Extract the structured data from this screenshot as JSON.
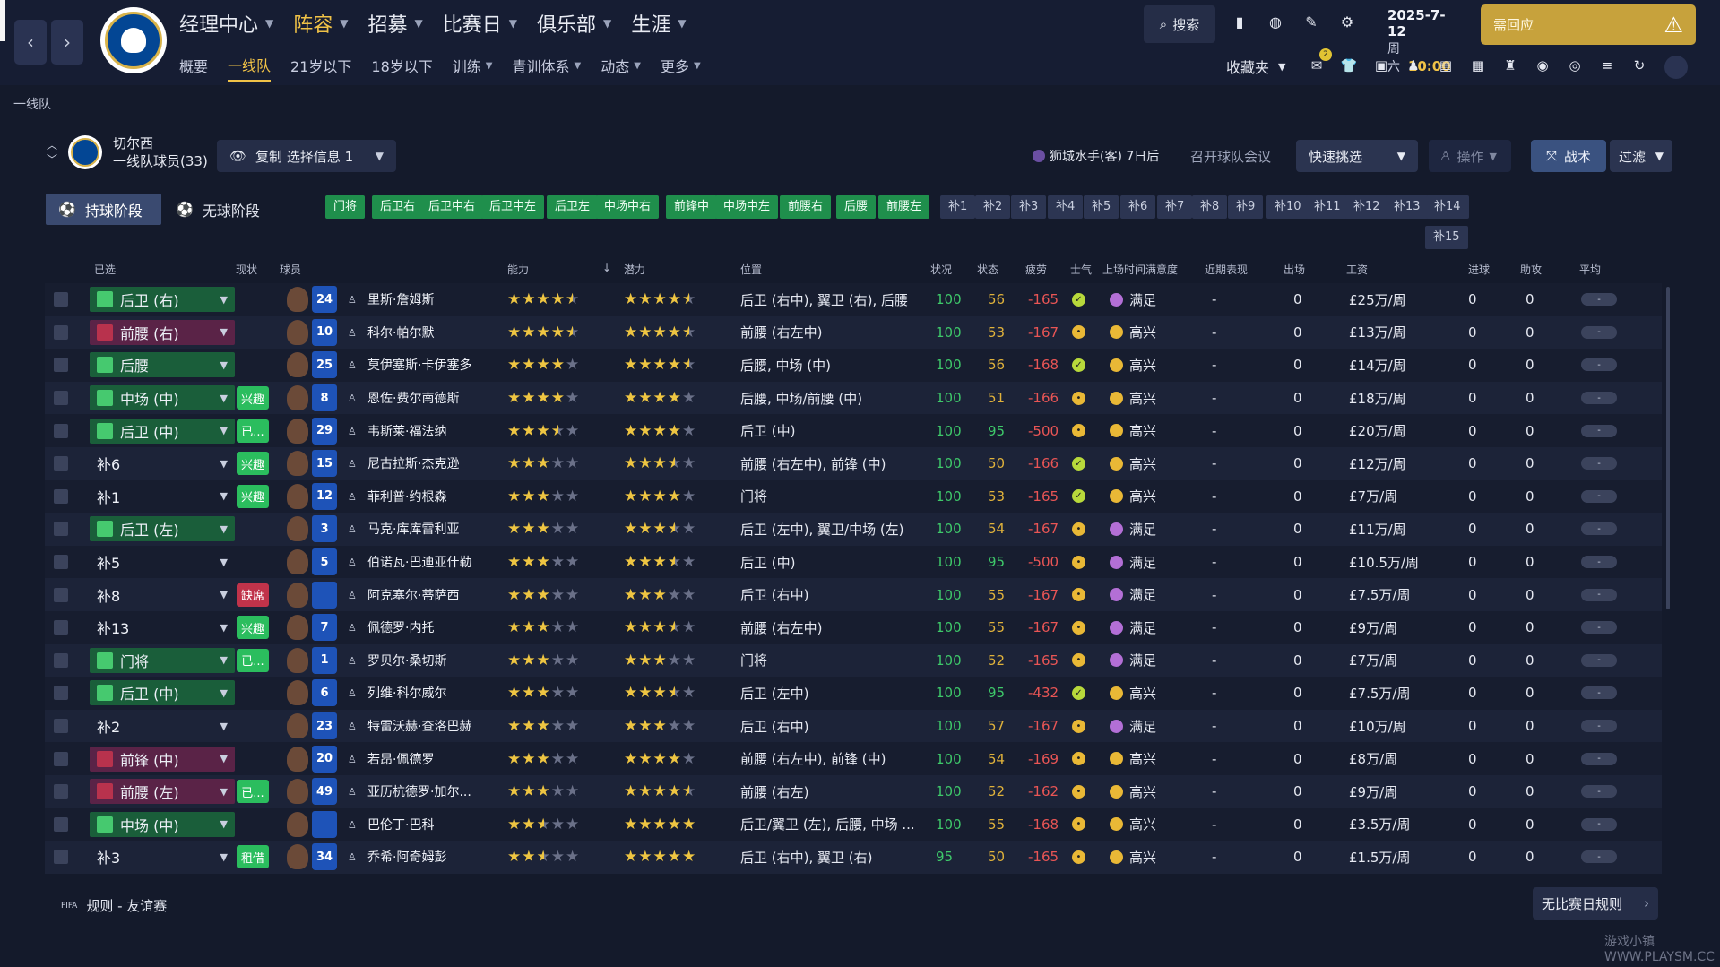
{
  "header": {
    "main_nav": [
      {
        "label": "经理中心",
        "active": false
      },
      {
        "label": "阵容",
        "active": true
      },
      {
        "label": "招募",
        "active": false
      },
      {
        "label": "比赛日",
        "active": false
      },
      {
        "label": "俱乐部",
        "active": false
      },
      {
        "label": "生涯",
        "active": false
      }
    ],
    "sub_nav": [
      {
        "label": "概要",
        "active": false,
        "dropdown": false
      },
      {
        "label": "一线队",
        "active": true,
        "dropdown": false
      },
      {
        "label": "21岁以下",
        "active": false,
        "dropdown": false
      },
      {
        "label": "18岁以下",
        "active": false,
        "dropdown": false
      },
      {
        "label": "训练",
        "active": false,
        "dropdown": true
      },
      {
        "label": "青训体系",
        "active": false,
        "dropdown": true
      },
      {
        "label": "动态",
        "active": false,
        "dropdown": true
      },
      {
        "label": "更多",
        "active": false,
        "dropdown": true
      }
    ],
    "search_label": "搜索",
    "date": "2025-7-12",
    "weekday": "周六",
    "time": "10:00",
    "respond_label": "需回应",
    "favorites_label": "收藏夹",
    "notification_count": "2",
    "accent_color": "#f0c247"
  },
  "breadcrumb": "一线队",
  "team": {
    "name": "切尔西",
    "squad_label": "一线队球员(33)",
    "copy_button": "复制 选择信息 1",
    "next_fixture": "狮城水手(客) 7日后",
    "meeting_label": "召开球队会议",
    "quick_pick_label": "快速挑选",
    "action_label": "操作",
    "tactics_label": "战术",
    "filter_label": "过滤"
  },
  "phases": {
    "in_possession": "持球阶段",
    "out_of_possession": "无球阶段"
  },
  "positions": [
    "门将",
    "后卫右",
    "后卫中右",
    "后卫中左",
    "后卫左",
    "中场中右",
    "前锋中",
    "中场中左",
    "前腰右",
    "后腰",
    "前腰左"
  ],
  "subs": [
    "补1",
    "补2",
    "补3",
    "补4",
    "补5",
    "补6",
    "补7",
    "补8",
    "补9",
    "补10",
    "补11",
    "补12",
    "补13",
    "补14",
    "补15"
  ],
  "columns": {
    "selected": "已选",
    "status": "现状",
    "player": "球员",
    "ability": "能力",
    "potential": "潜力",
    "position": "位置",
    "condition": "状况",
    "form": "状态",
    "fatigue": "疲劳",
    "morale": "士气",
    "playtime": "上场时间满意度",
    "recent": "近期表现",
    "apps": "出场",
    "wage": "工资",
    "goals": "进球",
    "assists": "助攻",
    "avg": "平均"
  },
  "players": [
    {
      "selected": "后卫 (右)",
      "sel_style": "green",
      "status": "",
      "status_style": "",
      "number": "24",
      "name": "里斯·詹姆斯",
      "ability": 4.5,
      "potential": 4.5,
      "position": "后卫 (右中), 翼卫 (右), 后腰",
      "condition": "100",
      "form": "56",
      "fatigue": "-165",
      "morale": "g",
      "playtime": "满足",
      "sat": "p",
      "recent": "-",
      "apps": "0",
      "wage": "£25万/周",
      "goals": "0",
      "assists": "0",
      "avg": "-"
    },
    {
      "selected": "前腰 (右)",
      "sel_style": "purple",
      "status": "",
      "status_style": "",
      "number": "10",
      "name": "科尔·帕尔默",
      "ability": 4.5,
      "potential": 4.5,
      "position": "前腰 (右左中)",
      "condition": "100",
      "form": "53",
      "fatigue": "-167",
      "morale": "y",
      "playtime": "高兴",
      "sat": "y",
      "recent": "-",
      "apps": "0",
      "wage": "£13万/周",
      "goals": "0",
      "assists": "0",
      "avg": "-"
    },
    {
      "selected": "后腰",
      "sel_style": "green",
      "status": "",
      "status_style": "",
      "number": "25",
      "name": "莫伊塞斯·卡伊塞多",
      "ability": 4.0,
      "potential": 4.5,
      "position": "后腰, 中场 (中)",
      "condition": "100",
      "form": "56",
      "fatigue": "-168",
      "morale": "g",
      "playtime": "高兴",
      "sat": "y",
      "recent": "-",
      "apps": "0",
      "wage": "£14万/周",
      "goals": "0",
      "assists": "0",
      "avg": "-"
    },
    {
      "selected": "中场 (中)",
      "sel_style": "green",
      "status": "兴趣",
      "status_style": "g",
      "number": "8",
      "name": "恩佐·费尔南德斯",
      "ability": 4.0,
      "potential": 4.0,
      "position": "后腰, 中场/前腰 (中)",
      "condition": "100",
      "form": "51",
      "fatigue": "-166",
      "morale": "y",
      "playtime": "高兴",
      "sat": "y",
      "recent": "-",
      "apps": "0",
      "wage": "£18万/周",
      "goals": "0",
      "assists": "0",
      "avg": "-"
    },
    {
      "selected": "后卫 (中)",
      "sel_style": "green",
      "status": "已...",
      "status_style": "g",
      "number": "29",
      "name": "韦斯莱·福法纳",
      "ability": 3.5,
      "potential": 4.0,
      "position": "后卫 (中)",
      "condition": "100",
      "form": "95",
      "fatigue": "-500",
      "morale": "y",
      "playtime": "高兴",
      "sat": "y",
      "recent": "-",
      "apps": "0",
      "wage": "£20万/周",
      "goals": "0",
      "assists": "0",
      "avg": "-"
    },
    {
      "selected": "补6",
      "sel_style": "none",
      "status": "兴趣",
      "status_style": "g",
      "number": "15",
      "name": "尼古拉斯·杰克逊",
      "ability": 3.0,
      "potential": 3.5,
      "position": "前腰 (右左中), 前锋 (中)",
      "condition": "100",
      "form": "50",
      "fatigue": "-166",
      "morale": "g",
      "playtime": "高兴",
      "sat": "y",
      "recent": "-",
      "apps": "0",
      "wage": "£12万/周",
      "goals": "0",
      "assists": "0",
      "avg": "-"
    },
    {
      "selected": "补1",
      "sel_style": "none",
      "status": "兴趣",
      "status_style": "g",
      "number": "12",
      "name": "菲利普·约根森",
      "ability": 3.0,
      "potential": 4.0,
      "position": "门将",
      "condition": "100",
      "form": "53",
      "fatigue": "-165",
      "morale": "g",
      "playtime": "高兴",
      "sat": "y",
      "recent": "-",
      "apps": "0",
      "wage": "£7万/周",
      "goals": "0",
      "assists": "0",
      "avg": "-"
    },
    {
      "selected": "后卫 (左)",
      "sel_style": "green",
      "status": "",
      "status_style": "",
      "number": "3",
      "name": "马克·库库雷利亚",
      "ability": 3.0,
      "potential": 3.5,
      "position": "后卫 (左中), 翼卫/中场 (左)",
      "condition": "100",
      "form": "54",
      "fatigue": "-167",
      "morale": "y",
      "playtime": "满足",
      "sat": "p",
      "recent": "-",
      "apps": "0",
      "wage": "£11万/周",
      "goals": "0",
      "assists": "0",
      "avg": "-"
    },
    {
      "selected": "补5",
      "sel_style": "none",
      "status": "",
      "status_style": "",
      "number": "5",
      "name": "伯诺瓦·巴迪亚什勒",
      "ability": 3.0,
      "potential": 3.5,
      "position": "后卫 (中)",
      "condition": "100",
      "form": "95",
      "fatigue": "-500",
      "morale": "y",
      "playtime": "满足",
      "sat": "p",
      "recent": "-",
      "apps": "0",
      "wage": "£10.5万/周",
      "goals": "0",
      "assists": "0",
      "avg": "-"
    },
    {
      "selected": "补8",
      "sel_style": "none",
      "status": "缺席",
      "status_style": "r",
      "number": "",
      "name": "阿克塞尔·蒂萨西",
      "ability": 3.0,
      "potential": 3.0,
      "position": "后卫 (右中)",
      "condition": "100",
      "form": "55",
      "fatigue": "-167",
      "morale": "y",
      "playtime": "满足",
      "sat": "p",
      "recent": "-",
      "apps": "0",
      "wage": "£7.5万/周",
      "goals": "0",
      "assists": "0",
      "avg": "-"
    },
    {
      "selected": "补13",
      "sel_style": "none",
      "status": "兴趣",
      "status_style": "g",
      "number": "7",
      "name": "佩德罗·内托",
      "ability": 3.0,
      "potential": 3.5,
      "position": "前腰 (右左中)",
      "condition": "100",
      "form": "55",
      "fatigue": "-167",
      "morale": "y",
      "playtime": "满足",
      "sat": "p",
      "recent": "-",
      "apps": "0",
      "wage": "£9万/周",
      "goals": "0",
      "assists": "0",
      "avg": "-"
    },
    {
      "selected": "门将",
      "sel_style": "green",
      "status": "已...",
      "status_style": "g",
      "number": "1",
      "name": "罗贝尔·桑切斯",
      "ability": 3.0,
      "potential": 3.0,
      "position": "门将",
      "condition": "100",
      "form": "52",
      "fatigue": "-165",
      "morale": "y",
      "playtime": "满足",
      "sat": "p",
      "recent": "-",
      "apps": "0",
      "wage": "£7万/周",
      "goals": "0",
      "assists": "0",
      "avg": "-"
    },
    {
      "selected": "后卫 (中)",
      "sel_style": "green",
      "status": "",
      "status_style": "",
      "number": "6",
      "name": "列维·科尔威尔",
      "ability": 3.0,
      "potential": 3.5,
      "position": "后卫 (左中)",
      "condition": "100",
      "form": "95",
      "fatigue": "-432",
      "morale": "g",
      "playtime": "高兴",
      "sat": "y",
      "recent": "-",
      "apps": "0",
      "wage": "£7.5万/周",
      "goals": "0",
      "assists": "0",
      "avg": "-"
    },
    {
      "selected": "补2",
      "sel_style": "none",
      "status": "",
      "status_style": "",
      "number": "23",
      "name": "特雷沃赫·查洛巴赫",
      "ability": 3.0,
      "potential": 3.0,
      "position": "后卫 (右中)",
      "condition": "100",
      "form": "57",
      "fatigue": "-167",
      "morale": "y",
      "playtime": "满足",
      "sat": "p",
      "recent": "-",
      "apps": "0",
      "wage": "£10万/周",
      "goals": "0",
      "assists": "0",
      "avg": "-"
    },
    {
      "selected": "前锋 (中)",
      "sel_style": "purple",
      "status": "",
      "status_style": "",
      "number": "20",
      "name": "若昂·佩德罗",
      "ability": 3.0,
      "potential": 4.0,
      "position": "前腰 (右左中), 前锋 (中)",
      "condition": "100",
      "form": "54",
      "fatigue": "-169",
      "morale": "y",
      "playtime": "高兴",
      "sat": "y",
      "recent": "-",
      "apps": "0",
      "wage": "£8万/周",
      "goals": "0",
      "assists": "0",
      "avg": "-"
    },
    {
      "selected": "前腰 (左)",
      "sel_style": "purple",
      "status": "已...",
      "status_style": "g",
      "number": "49",
      "name": "亚历杭德罗·加尔...",
      "ability": 3.0,
      "potential": 4.5,
      "position": "前腰 (右左)",
      "condition": "100",
      "form": "52",
      "fatigue": "-162",
      "morale": "y",
      "playtime": "高兴",
      "sat": "y",
      "recent": "-",
      "apps": "0",
      "wage": "£9万/周",
      "goals": "0",
      "assists": "0",
      "avg": "-"
    },
    {
      "selected": "中场 (中)",
      "sel_style": "green",
      "status": "",
      "status_style": "",
      "number": "",
      "name": "巴伦丁·巴科",
      "ability": 2.5,
      "potential": 5.0,
      "position": "后卫/翼卫 (左), 后腰, 中场 ...",
      "condition": "100",
      "form": "55",
      "fatigue": "-168",
      "morale": "y",
      "playtime": "高兴",
      "sat": "y",
      "recent": "-",
      "apps": "0",
      "wage": "£3.5万/周",
      "goals": "0",
      "assists": "0",
      "avg": "-"
    },
    {
      "selected": "补3",
      "sel_style": "none",
      "status": "租借",
      "status_style": "g",
      "number": "34",
      "name": "乔希·阿奇姆彭",
      "ability": 2.5,
      "potential": 5.0,
      "position": "后卫 (右中), 翼卫 (右)",
      "condition": "95",
      "form": "50",
      "fatigue": "-165",
      "morale": "y",
      "playtime": "高兴",
      "sat": "y",
      "recent": "-",
      "apps": "0",
      "wage": "£1.5万/周",
      "goals": "0",
      "assists": "0",
      "avg": "-"
    }
  ],
  "footer": {
    "rules_label": "规则 - 友谊赛",
    "fifa_label": "FIFA",
    "no_match_rules": "无比赛日规则",
    "watermark": "游戏小镇 WWW.PLAYSM.CC"
  }
}
